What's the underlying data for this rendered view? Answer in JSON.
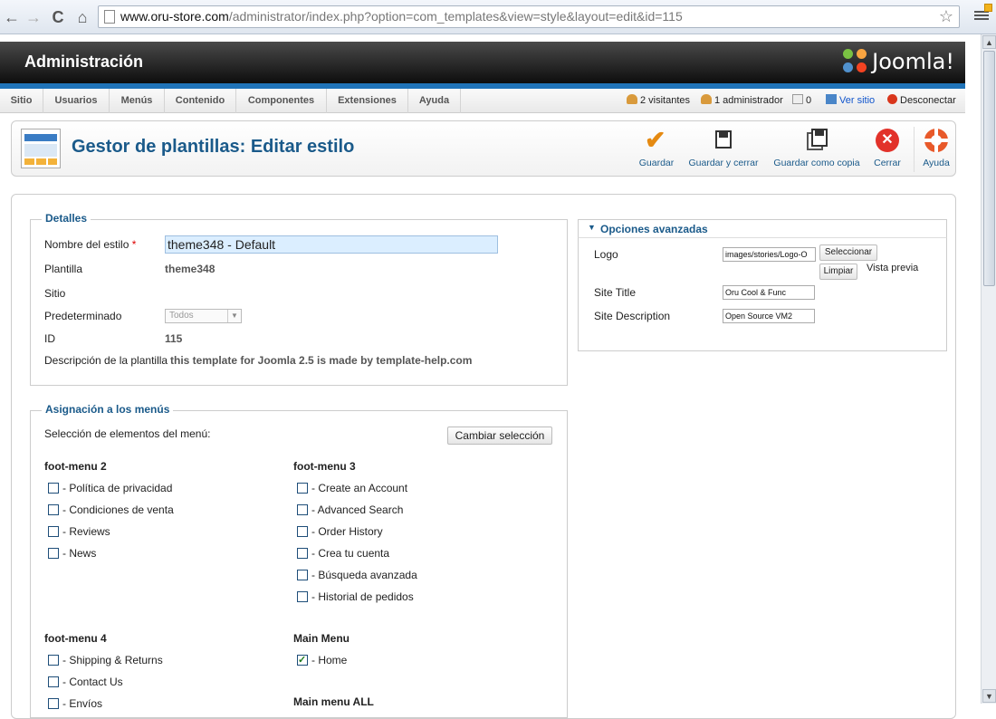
{
  "browser": {
    "url_host": "www.oru-store.com",
    "url_path": "/administrator/index.php?option=com_templates&view=style&layout=edit&id=115"
  },
  "header": {
    "title": "Administración",
    "logo_text": "Joomla!"
  },
  "menu": {
    "items": [
      "Sitio",
      "Usuarios",
      "Menús",
      "Contenido",
      "Componentes",
      "Extensiones",
      "Ayuda"
    ]
  },
  "status": {
    "visitors": "2 visitantes",
    "admins": "1 administrador",
    "messages": "0",
    "view_site": "Ver sitio",
    "logout": "Desconectar"
  },
  "toolbar": {
    "page_title": "Gestor de plantillas: Editar estilo",
    "save": "Guardar",
    "save_close": "Guardar y cerrar",
    "save_copy": "Guardar como copia",
    "close": "Cerrar",
    "help": "Ayuda"
  },
  "details": {
    "legend": "Detalles",
    "style_name_label": "Nombre del estilo",
    "required_mark": "*",
    "style_name_value": "theme348 - Default",
    "template_label": "Plantilla",
    "template_value": "theme348",
    "site_label": "Sitio",
    "default_label": "Predeterminado",
    "default_value": "Todos",
    "id_label": "ID",
    "id_value": "115",
    "description_label": "Descripción de la plantilla",
    "description_value": "this template for Joomla 2.5 is made by template-help.com"
  },
  "advanced": {
    "title": "Opciones avanzadas",
    "logo_label": "Logo",
    "logo_value": "images/stories/Logo-O",
    "select_button": "Seleccionar",
    "clear_button": "Limpiar",
    "preview_label": "Vista previa",
    "site_title_label": "Site Title",
    "site_title_value": "Oru Cool & Func",
    "site_desc_label": "Site Description",
    "site_desc_value": "Open Source VM2"
  },
  "assignment": {
    "legend": "Asignación a los menús",
    "selection_label": "Selección de elementos del menú:",
    "toggle_button": "Cambiar selección",
    "groups": [
      {
        "title": "foot-menu 2",
        "items": [
          {
            "label": "- Política de privacidad",
            "checked": false
          },
          {
            "label": "- Condiciones de venta",
            "checked": false
          },
          {
            "label": "- Reviews",
            "checked": false
          },
          {
            "label": "- News",
            "checked": false
          }
        ]
      },
      {
        "title": "foot-menu 3",
        "items": [
          {
            "label": "- Create an Account",
            "checked": false
          },
          {
            "label": "- Advanced Search",
            "checked": false
          },
          {
            "label": "- Order History",
            "checked": false
          },
          {
            "label": "- Crea tu cuenta",
            "checked": false
          },
          {
            "label": "- Búsqueda avanzada",
            "checked": false
          },
          {
            "label": "- Historial de pedidos",
            "checked": false
          }
        ]
      },
      {
        "title": "foot-menu 4",
        "items": [
          {
            "label": "- Shipping & Returns",
            "checked": false
          },
          {
            "label": "- Contact Us",
            "checked": false
          },
          {
            "label": "- Envíos",
            "checked": false
          }
        ]
      },
      {
        "title": "Main Menu",
        "items": [
          {
            "label": "- Home",
            "checked": true
          }
        ]
      },
      {
        "title": "Main menu ALL",
        "items": []
      }
    ]
  }
}
